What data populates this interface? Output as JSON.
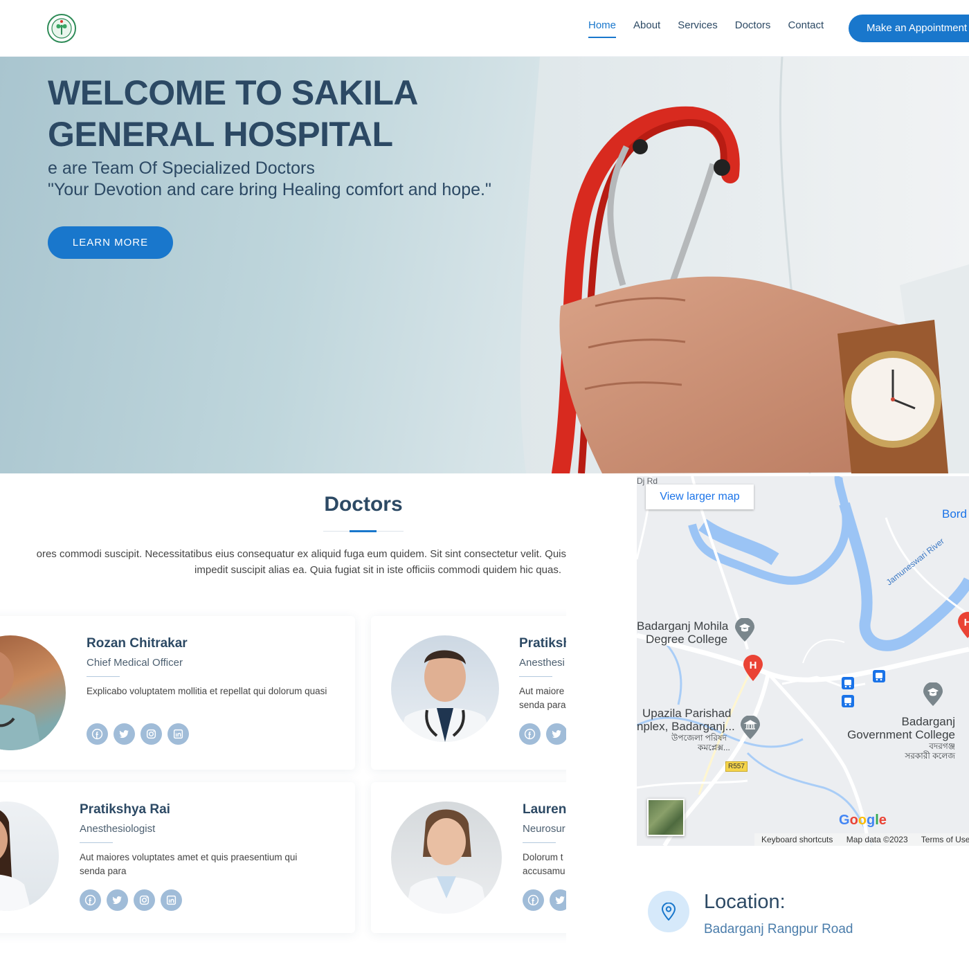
{
  "header": {
    "nav": [
      "Home",
      "About",
      "Services",
      "Doctors",
      "Contact"
    ],
    "active": "Home",
    "appointment_label": "Make an Appointment"
  },
  "hero": {
    "title_line1": "WELCOME TO SAKILA",
    "title_line2": "GENERAL HOSPITAL",
    "subtitle_line1": "e are Team Of Specialized Doctors",
    "subtitle_line2": "\"Your Devotion and care bring Healing comfort and hope.\"",
    "button_label": "LEARN MORE"
  },
  "doctors": {
    "title": "Doctors",
    "desc_line1": "ores commodi suscipit. Necessitatibus eius consequatur ex aliquid fuga eum quidem. Sit sint consectetur velit. Quis",
    "desc_line2": "impedit suscipit alias ea. Quia fugiat sit in iste officiis commodi quidem hic quas.",
    "cards": [
      {
        "name": "Rozan Chitrakar",
        "role": "Chief Medical Officer",
        "desc": "Explicabo voluptatem mollitia et repellat qui dolorum quasi"
      },
      {
        "name": "Pratiksh",
        "role": "Anesthesi",
        "desc": "Aut maiore senda para"
      },
      {
        "name": "Pratikshya Rai",
        "role": "Anesthesiologist",
        "desc": "Aut maiores voluptates amet et quis praesentium qui senda para"
      },
      {
        "name": "Lauren",
        "role": "Neurosur",
        "desc": "Dolorum t accusamu"
      }
    ]
  },
  "map": {
    "view_larger": "View larger map",
    "labels": {
      "road_top": "Dj Rd",
      "bord": "Bord",
      "river": "Jamuneswari River",
      "college1_a": "Badarganj Mohila",
      "college1_b": "Degree College",
      "upazila_a": "Upazila Parishad",
      "upazila_b": "nplex, Badarganj...",
      "upazila_c": "উপজেলা পরিষদ",
      "upazila_d": "কমপ্লেক্স...",
      "govt_a": "Badarganj",
      "govt_b": "Government College",
      "govt_c": "বদরগঞ্জ",
      "govt_d": "সরকারী কলেজ",
      "road_badge": "R557",
      "google": "Google"
    },
    "footer": [
      "Keyboard shortcuts",
      "Map data ©2023",
      "Terms of Use"
    ]
  },
  "location": {
    "title": "Location:",
    "text": "Badarganj Rangpur Road"
  },
  "colors": {
    "accent": "#1977cc",
    "heading": "#2c4964",
    "social": "#a0bcd8"
  },
  "icons": [
    "logo-icon",
    "facebook-icon",
    "twitter-icon",
    "instagram-icon",
    "linkedin-icon",
    "location-pin-icon"
  ]
}
